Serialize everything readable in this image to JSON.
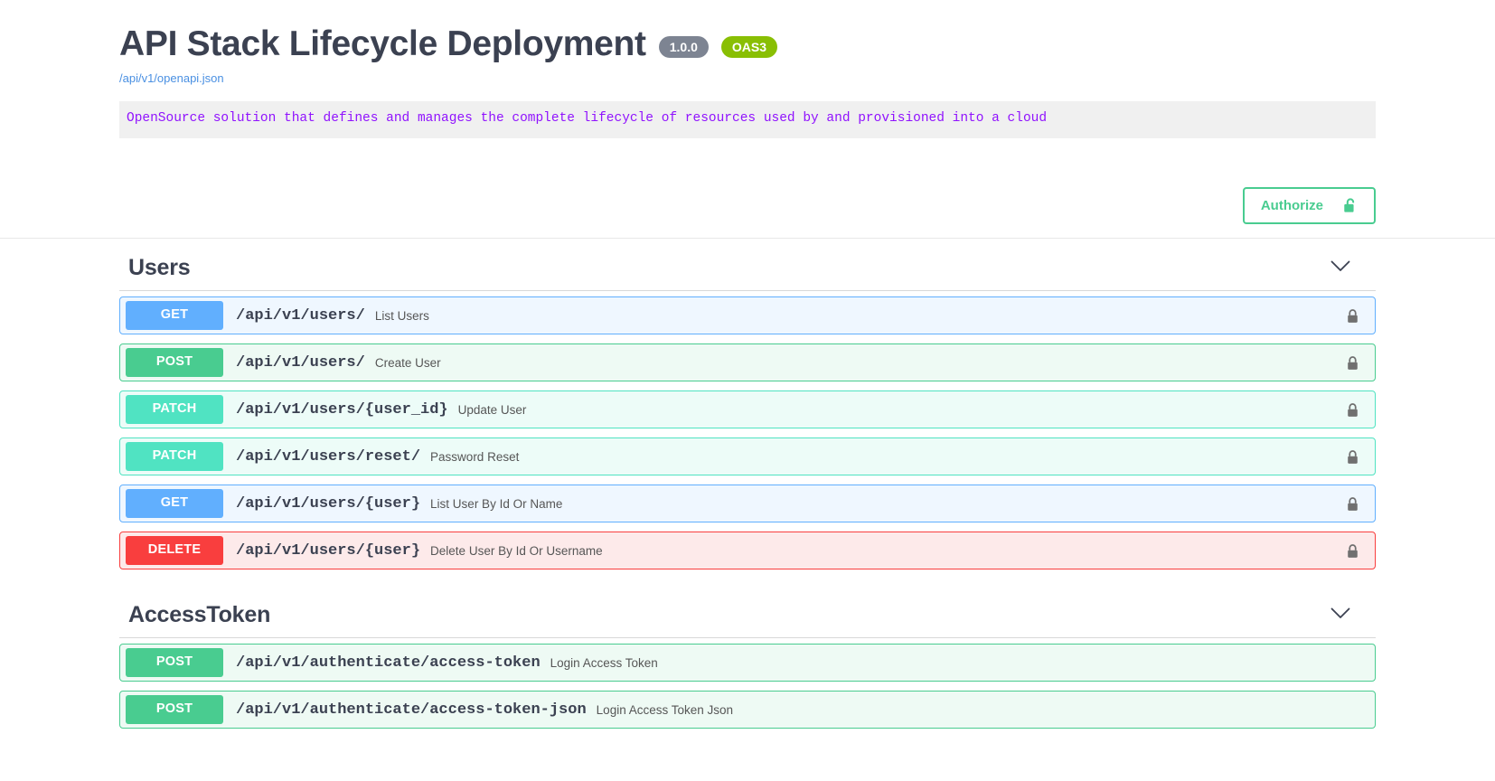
{
  "header": {
    "title": "API Stack Lifecycle Deployment",
    "version_badge": "1.0.0",
    "oas_badge": "OAS3",
    "spec_url": "/api/v1/openapi.json",
    "description": "OpenSource solution that defines and manages the complete lifecycle of resources used by and provisioned into a cloud"
  },
  "auth": {
    "authorize_label": "Authorize",
    "lock_icon": "unlock-icon"
  },
  "colors": {
    "get": "#61affe",
    "post": "#49cc90",
    "patch": "#50e3c2",
    "delete": "#f93e3e",
    "oas_badge": "#89bf04",
    "version_badge": "#7d8492",
    "authorize": "#49cc90",
    "title_text": "#3b4151",
    "spec_link": "#4a90e2",
    "description_text": "#9012fe"
  },
  "sections": [
    {
      "tag": "Users",
      "collapse_icon": "chevron-down-icon",
      "operations": [
        {
          "method": "GET",
          "path": "/api/v1/users/",
          "summary": "List Users",
          "locked": true,
          "lock_icon": "lock-icon"
        },
        {
          "method": "POST",
          "path": "/api/v1/users/",
          "summary": "Create User",
          "locked": true,
          "lock_icon": "lock-icon"
        },
        {
          "method": "PATCH",
          "path": "/api/v1/users/{user_id}",
          "summary": "Update User",
          "locked": true,
          "lock_icon": "lock-icon"
        },
        {
          "method": "PATCH",
          "path": "/api/v1/users/reset/",
          "summary": "Password Reset",
          "locked": true,
          "lock_icon": "lock-icon"
        },
        {
          "method": "GET",
          "path": "/api/v1/users/{user}",
          "summary": "List User By Id Or Name",
          "locked": true,
          "lock_icon": "lock-icon"
        },
        {
          "method": "DELETE",
          "path": "/api/v1/users/{user}",
          "summary": "Delete User By Id Or Username",
          "locked": true,
          "lock_icon": "lock-icon"
        }
      ]
    },
    {
      "tag": "AccessToken",
      "collapse_icon": "chevron-down-icon",
      "operations": [
        {
          "method": "POST",
          "path": "/api/v1/authenticate/access-token",
          "summary": "Login Access Token",
          "locked": false,
          "lock_icon": "lock-icon"
        },
        {
          "method": "POST",
          "path": "/api/v1/authenticate/access-token-json",
          "summary": "Login Access Token Json",
          "locked": false,
          "lock_icon": "lock-icon"
        }
      ]
    }
  ]
}
